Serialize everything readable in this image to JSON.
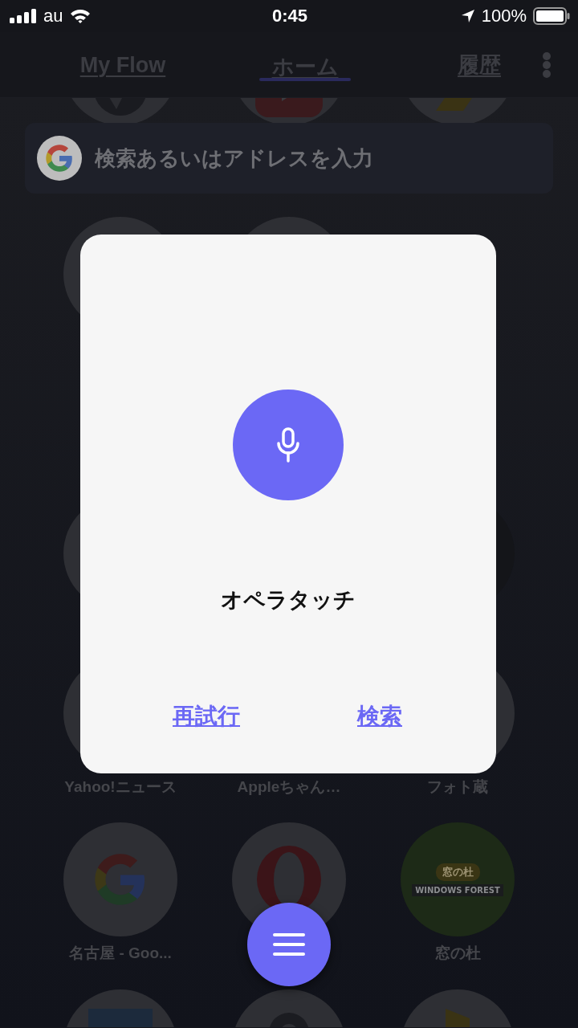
{
  "status_bar": {
    "carrier": "au",
    "time": "0:45",
    "battery": "100%"
  },
  "tabs": [
    {
      "label": "My Flow",
      "selected": false
    },
    {
      "label": "ホーム",
      "selected": true
    },
    {
      "label": "履歴",
      "selected": false
    }
  ],
  "search": {
    "placeholder": "検索あるいはアドレスを入力"
  },
  "tile_rows": [
    [
      {
        "kind": "aperture"
      },
      {
        "kind": "play"
      },
      {
        "kind": "chevron"
      }
    ],
    [
      {
        "kind": "blank"
      },
      {
        "kind": "blank"
      }
    ],
    [
      {
        "kind": "blank"
      },
      {
        "kind": "covered"
      },
      {
        "kind": "dark"
      }
    ],
    [
      {
        "kind": "blank",
        "label": "Yahoo!ニュース"
      },
      {
        "kind": "covered",
        "label": "Appleちゃん…"
      },
      {
        "kind": "blank",
        "label": "フォト蔵"
      }
    ],
    [
      {
        "kind": "google",
        "label": "名古屋 - Goo..."
      },
      {
        "kind": "opera"
      },
      {
        "kind": "logo",
        "label": "窓の杜",
        "logo_text": "窓の杜",
        "logo_subtext": "WINDOWS FOREST"
      }
    ],
    [
      {
        "kind": "bluebar"
      },
      {
        "kind": "darkarc"
      },
      {
        "kind": "yellowbar"
      }
    ]
  ],
  "dialog": {
    "title": "オペラタッチ",
    "buttons": [
      "再試行",
      "検索"
    ]
  }
}
